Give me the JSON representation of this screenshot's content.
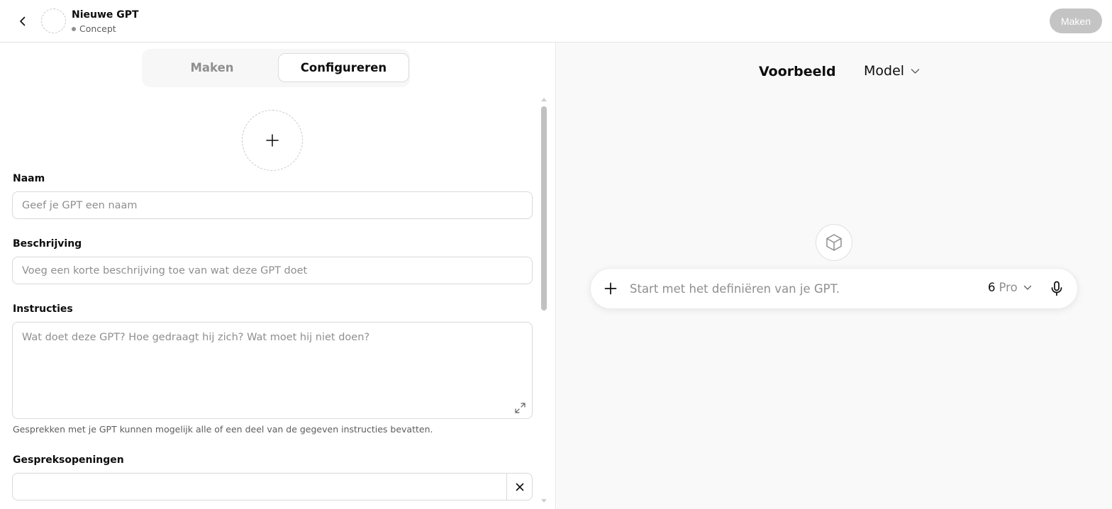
{
  "header": {
    "title": "Nieuwe GPT",
    "status": "Concept",
    "make_button": "Maken"
  },
  "tabs": [
    {
      "label": "Maken",
      "active": false
    },
    {
      "label": "Configureren",
      "active": true
    }
  ],
  "form": {
    "name": {
      "label": "Naam",
      "placeholder": "Geef je GPT een naam",
      "value": ""
    },
    "description": {
      "label": "Beschrijving",
      "placeholder": "Voeg een korte beschrijving toe van wat deze GPT doet",
      "value": ""
    },
    "instructions": {
      "label": "Instructies",
      "placeholder": "Wat doet deze GPT? Hoe gedraagt hij zich? Wat moet hij niet doen?",
      "value": "",
      "helper": "Gesprekken met je GPT kunnen mogelijk alle of een deel van de gegeven instructies bevatten."
    },
    "conversation_starters": {
      "label": "Gespreksopeningen",
      "value": ""
    }
  },
  "preview": {
    "title": "Voorbeeld",
    "model_label": "Model",
    "composer_placeholder": "Start met het definiëren van je GPT.",
    "model_number": "6",
    "model_tier": "Pro"
  },
  "icons": {
    "back": "chevron-left-icon",
    "avatar_add": "plus-icon",
    "expand": "expand-icon",
    "remove": "close-icon",
    "model_chevron": "chevron-down-icon",
    "cube": "cube-icon",
    "composer_add": "plus-icon",
    "mic": "microphone-icon"
  },
  "colors": {
    "accent_disabled": "#c4c4c4",
    "border": "#d9d9d9",
    "muted_text": "#8f8f8f",
    "preview_bg": "#f9f9f9"
  }
}
